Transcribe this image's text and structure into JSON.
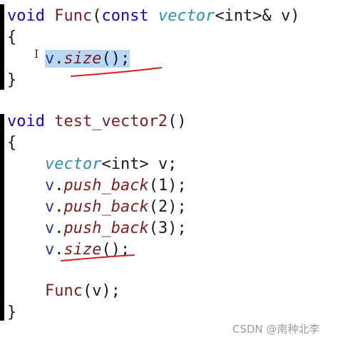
{
  "code": {
    "func": {
      "kw_void": "void",
      "name": "Func",
      "open": "(",
      "kw_const": "const",
      "type": "vector",
      "tmpl": "<int>& v)",
      "brace_open": "{",
      "body_var": "v",
      "body_dot": ".",
      "body_method": "size",
      "body_call": "();",
      "brace_close": "}"
    },
    "test": {
      "kw_void": "void",
      "name": "test_vector2",
      "parens": "()",
      "brace_open": "{",
      "decl_type": "vector",
      "decl_rest": "<int> v;",
      "push1_var": "v",
      "push1_method": "push_back",
      "push1_args": "(1);",
      "push2_var": "v",
      "push2_method": "push_back",
      "push2_args": "(2);",
      "push3_var": "v",
      "push3_method": "push_back",
      "push3_args": "(3);",
      "size_var": "v",
      "size_method": "size",
      "size_call": "();",
      "call_name": "Func",
      "call_args": "(v);",
      "brace_close": "}"
    }
  },
  "annotation_color": "#d81e1e",
  "selection_color": "#b7d8f7",
  "watermark": "CSDN @南种北李"
}
